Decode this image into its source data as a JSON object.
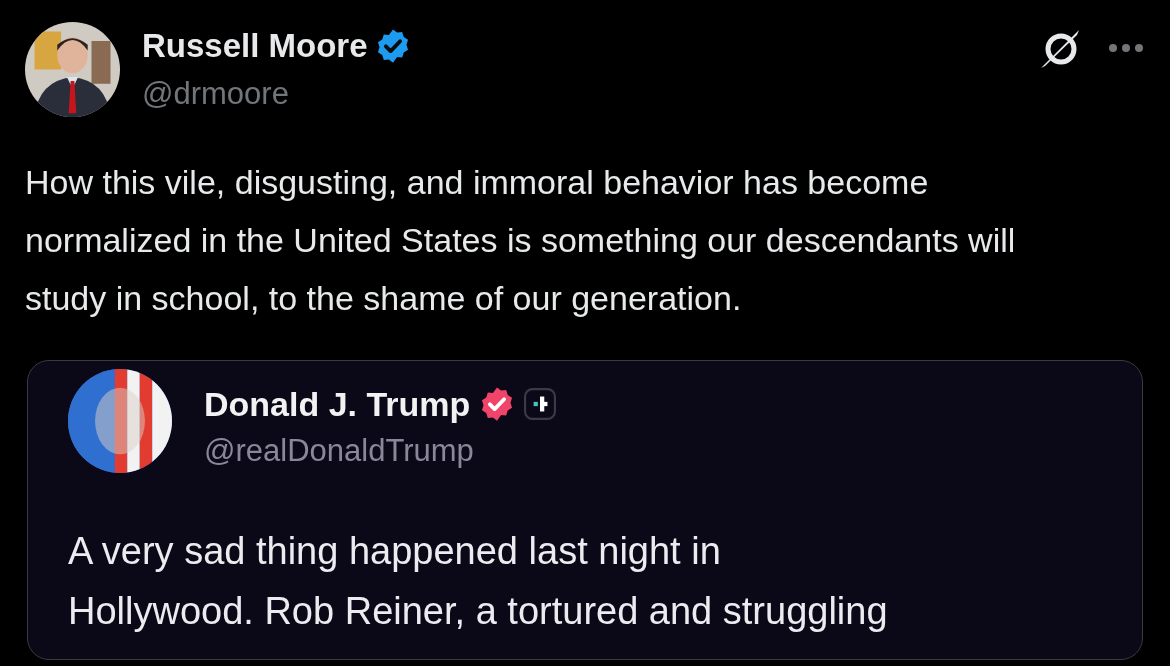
{
  "post": {
    "author": {
      "name": "Russell Moore",
      "handle": "@drmoore",
      "verified": true
    },
    "text": "How this vile, disgusting, and immoral behavior has become normalized in the United States is something our descendants will study in school, to the shame of our generation.",
    "quote": {
      "author": {
        "name": "Donald J. Trump",
        "handle": "@realDonaldTrump",
        "verified": true
      },
      "lines": [
        "A very sad thing happened last night in",
        "Hollywood. Rob Reiner, a tortured and struggling"
      ]
    }
  }
}
